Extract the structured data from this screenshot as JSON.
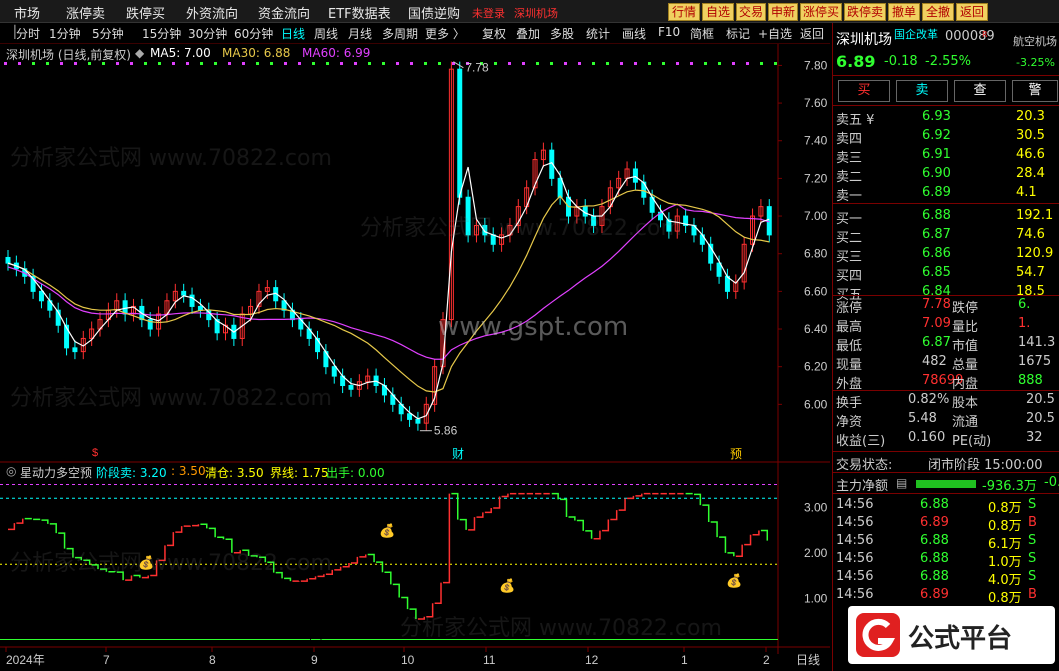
{
  "menu": {
    "items": [
      "市场",
      "涨停卖",
      "跌停买",
      "外资流向",
      "资金流向",
      "ETF数据表",
      "国债逆购",
      "未登录",
      "深圳机场"
    ],
    "buttons": [
      "行情",
      "自选",
      "交易",
      "申新",
      "涨停买",
      "跌停卖",
      "撤单",
      "全撤",
      "返回"
    ]
  },
  "periods": [
    "分时",
    "1分钟",
    "5分钟",
    "15分钟",
    "30分钟",
    "60分钟",
    "日线",
    "周线",
    "月线",
    "多周期",
    "更多 〉"
  ],
  "tools": [
    "复权",
    "叠加",
    "多股",
    "统计",
    "画线",
    "F10",
    "简框",
    "标记",
    "+自选",
    "返回"
  ],
  "chart_header": {
    "title": "深圳机场 (日线,前复权)",
    "ma5": "MA5: 7.00",
    "ma30": "MA30: 6.88",
    "ma60": "MA60: 6.99"
  },
  "indicator_header": {
    "name": "星动力多空预",
    "items": [
      "阶段卖: 3.20",
      ": 3.50",
      "清仓: 3.50",
      "界线: 1.75",
      "出手: 0.00"
    ]
  },
  "annotations": {
    "high": "7.78",
    "low": "5.86",
    "cai": "财",
    "yu": "预",
    "s_mark": "$"
  },
  "price_axis": [
    "7.80",
    "7.60",
    "7.40",
    "7.20",
    "7.00",
    "6.80",
    "6.60",
    "6.40",
    "6.20",
    "6.00"
  ],
  "ind_axis": [
    "3.00",
    "2.00",
    "1.00"
  ],
  "date_axis": [
    "2024年",
    "7",
    "8",
    "9",
    "10",
    "11",
    "12",
    "1",
    "2"
  ],
  "period_label": "日线",
  "watermarks": {
    "main": "www.gspt.com",
    "faint": "分析家公式网 www.70822.com"
  },
  "stock": {
    "name": "深圳机场",
    "tag": "国企改革",
    "code": "000089",
    "sector": "航空机场",
    "price": "6.89",
    "change": "-0.18",
    "pct": "-2.55%",
    "sector_pct": "-3.25%",
    "trade_buttons": [
      "买",
      "卖",
      "查",
      "警"
    ]
  },
  "orderbook": {
    "sell": [
      {
        "label": "卖五 ¥",
        "price": "6.93",
        "vol": "20.3"
      },
      {
        "label": "卖四",
        "price": "6.92",
        "vol": "30.5"
      },
      {
        "label": "卖三",
        "price": "6.91",
        "vol": "46.6"
      },
      {
        "label": "卖二",
        "price": "6.90",
        "vol": "28.4"
      },
      {
        "label": "卖一",
        "price": "6.89",
        "vol": "4.1"
      }
    ],
    "buy": [
      {
        "label": "买一",
        "price": "6.88",
        "vol": "192.1"
      },
      {
        "label": "买二",
        "price": "6.87",
        "vol": "74.6"
      },
      {
        "label": "买三",
        "price": "6.86",
        "vol": "120.9"
      },
      {
        "label": "买四",
        "price": "6.85",
        "vol": "54.7"
      },
      {
        "label": "买五",
        "price": "6.84",
        "vol": "18.5"
      }
    ]
  },
  "stats": [
    {
      "l1": "涨停",
      "v1": "7.78",
      "l2": "跌停",
      "v2": "6."
    },
    {
      "l1": "最高",
      "v1": "7.09",
      "l2": "量比",
      "v2": "1."
    },
    {
      "l1": "最低",
      "v1": "6.87",
      "l2": "市值",
      "v2": "141.3"
    },
    {
      "l1": "现量",
      "v1": "482",
      "l2": "总量",
      "v2": "1675"
    },
    {
      "l1": "外盘",
      "v1": "78699",
      "l2": "内盘",
      "v2": "888"
    }
  ],
  "stats2": [
    {
      "l1": "换手",
      "v1": "0.82%",
      "l2": "股本",
      "v2": "20.5"
    },
    {
      "l1": "净资",
      "v1": "5.48",
      "l2": "流通",
      "v2": "20.5"
    },
    {
      "l1": "收益(三)",
      "v1": "0.160",
      "l2": "PE(动)",
      "v2": "32"
    }
  ],
  "status": {
    "label": "交易状态:",
    "value": "闭市阶段 15:00:00"
  },
  "flow": {
    "label": "主力净额",
    "value": "-936.3万",
    "extra": "-0."
  },
  "ticks": [
    {
      "t": "14:56",
      "p": "6.88",
      "v": "0.8万",
      "s": "S"
    },
    {
      "t": "14:56",
      "p": "6.89",
      "v": "0.8万",
      "s": "B"
    },
    {
      "t": "14:56",
      "p": "6.88",
      "v": "6.1万",
      "s": "S"
    },
    {
      "t": "14:56",
      "p": "6.88",
      "v": "1.0万",
      "s": "S"
    },
    {
      "t": "14:56",
      "p": "6.88",
      "v": "4.0万",
      "s": "S"
    },
    {
      "t": "14:56",
      "p": "6.89",
      "v": "0.8万",
      "s": "B"
    }
  ],
  "logo": {
    "text": "公式平台"
  },
  "colors": {
    "up": "#ff3030",
    "down": "#00ffff",
    "ma5": "#ffffff",
    "ma30": "#e6c84a",
    "ma60": "#e040ff",
    "green": "#30ff30",
    "yellow": "#ffff00"
  },
  "chart_data": {
    "type": "candlestick",
    "title": "深圳机场 (日线,前复权)",
    "ylim": [
      5.8,
      7.85
    ],
    "x_labels": [
      "2024年",
      "7",
      "8",
      "9",
      "10",
      "11",
      "12",
      "1",
      "2"
    ],
    "close": [
      6.75,
      6.72,
      6.68,
      6.6,
      6.55,
      6.5,
      6.42,
      6.3,
      6.28,
      6.35,
      6.4,
      6.45,
      6.5,
      6.55,
      6.48,
      6.52,
      6.45,
      6.4,
      6.48,
      6.55,
      6.6,
      6.58,
      6.52,
      6.5,
      6.45,
      6.38,
      6.42,
      6.35,
      6.48,
      6.52,
      6.6,
      6.62,
      6.55,
      6.5,
      6.45,
      6.4,
      6.35,
      6.28,
      6.2,
      6.15,
      6.1,
      6.08,
      6.12,
      6.15,
      6.1,
      6.05,
      6.0,
      5.95,
      5.92,
      5.9,
      6.0,
      6.2,
      6.45,
      7.78,
      7.1,
      6.9,
      6.95,
      6.9,
      6.85,
      6.9,
      6.95,
      7.05,
      7.15,
      7.3,
      7.35,
      7.2,
      7.1,
      7.0,
      7.05,
      7.0,
      6.95,
      7.05,
      7.15,
      7.2,
      7.25,
      7.18,
      7.1,
      7.02,
      6.98,
      6.92,
      7.0,
      6.95,
      6.9,
      6.85,
      6.75,
      6.68,
      6.6,
      6.65,
      6.85,
      7.0,
      7.05,
      6.9
    ]
  }
}
